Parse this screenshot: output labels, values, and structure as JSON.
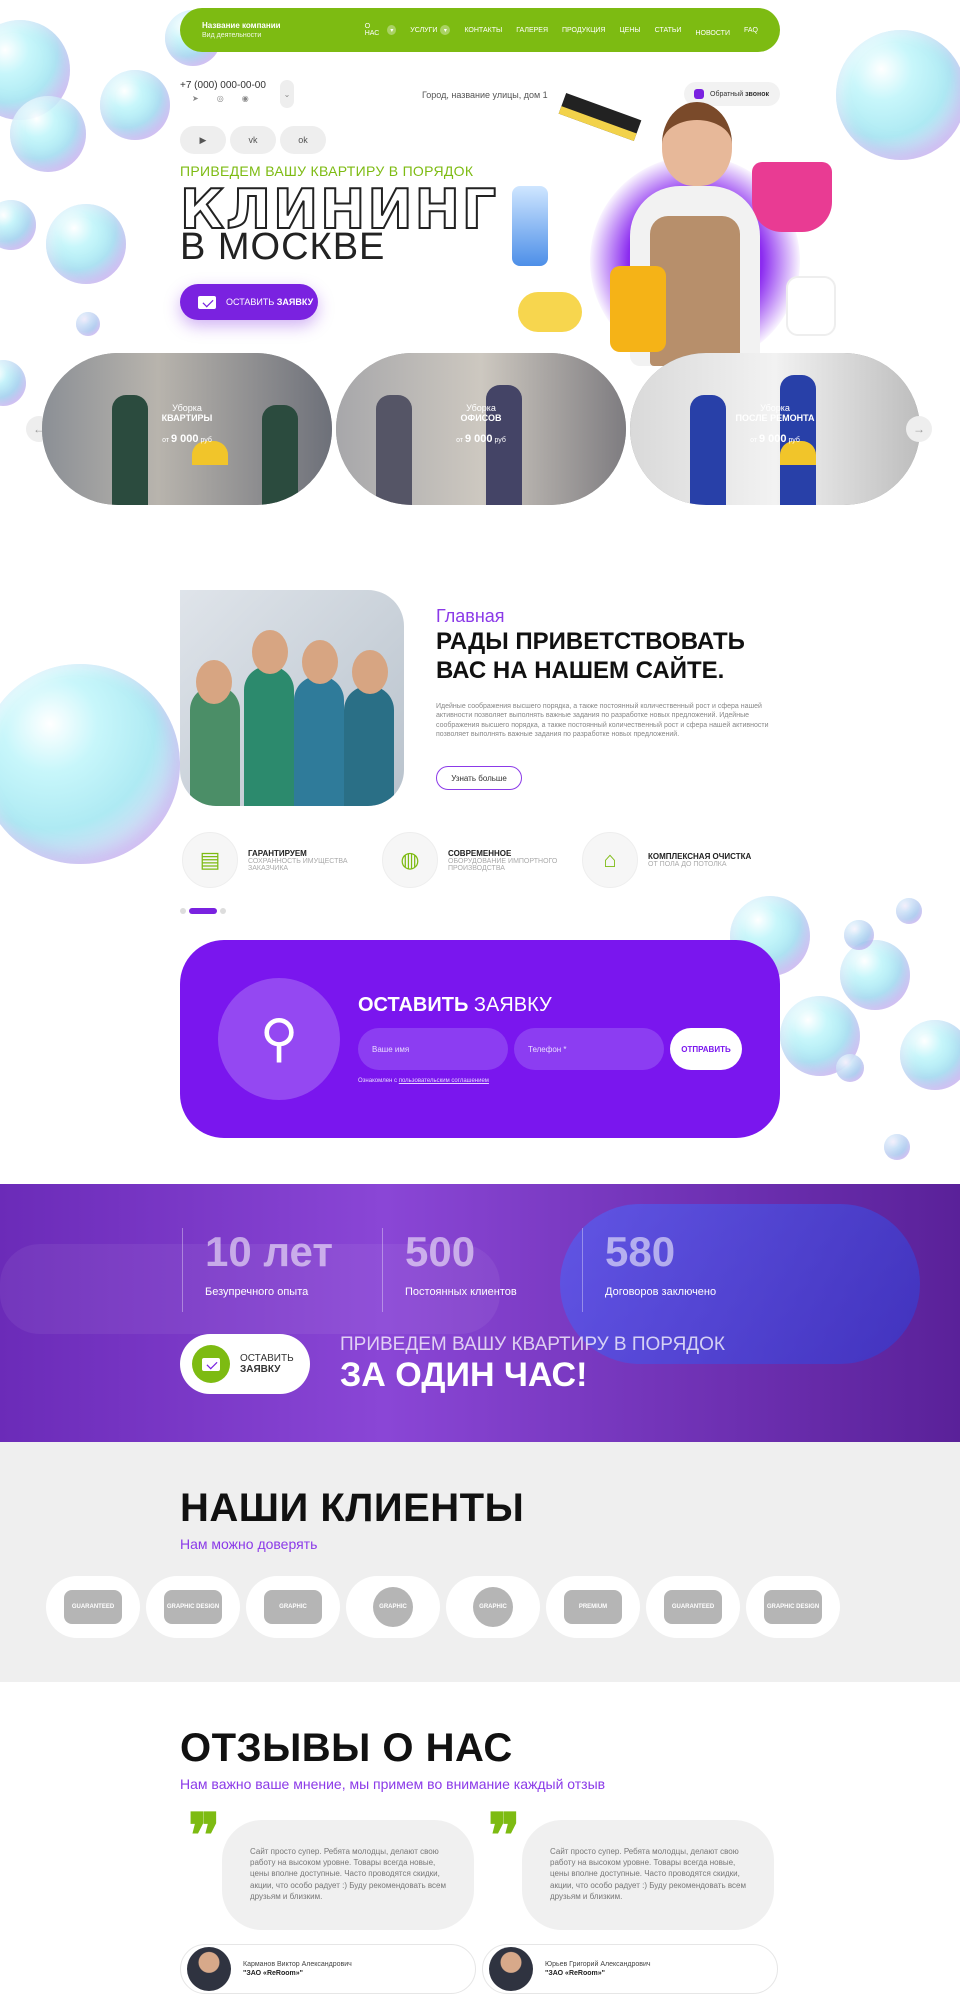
{
  "header": {
    "company_name": "Название компании",
    "company_sub": "Вид деятельности",
    "nav": [
      "О нас",
      "Услуги",
      "Контакты",
      "Галерея",
      "Продукция",
      "Цены",
      "Статьи",
      "Новости",
      "FAQ"
    ]
  },
  "contacts": {
    "phone": "+7 (000) 000-00-00",
    "address": "Город, название улицы, дом 1",
    "callback_prefix": "Обратный",
    "callback_bold": "звонок",
    "socials": [
      "▶",
      "vk",
      "ok"
    ]
  },
  "hero": {
    "subtitle": "Приведем вашу квартиру в порядок",
    "title": "КЛИНИНГ",
    "title2": "В МОСКВЕ",
    "button_prefix": "ОСТАВИТЬ",
    "button_bold": "ЗАЯВКУ"
  },
  "services": [
    {
      "line1": "Уборка",
      "line2": "квартиры",
      "price_prefix": "от",
      "price": "9 000",
      "unit": "руб"
    },
    {
      "line1": "Уборка",
      "line2": "офисов",
      "price_prefix": "от",
      "price": "9 000",
      "unit": "руб"
    },
    {
      "line1": "Уборка",
      "line2": "после ремонта",
      "price_prefix": "от",
      "price": "9 000",
      "unit": "руб"
    }
  ],
  "about": {
    "tag": "Главная",
    "title": "Рады приветствовать вас на нашем сайте.",
    "text": "Идейные соображения высшего порядка, а также постоянный количественный рост и сфера нашей активности позволяет выполнять важные задания по разработке новых предложений. Идейные соображения высшего порядка, а также постоянный количественный рост и сфера нашей активности позволяет выполнять важные задания по разработке новых предложений.",
    "button": "Узнать больше",
    "features": [
      {
        "title": "Гарантируем",
        "text": "сохранность имущества заказчика"
      },
      {
        "title": "Современное",
        "text": "оборудование импортного производства"
      },
      {
        "title": "Комплексная очистка",
        "text": "от пола до потолка"
      }
    ]
  },
  "request": {
    "title_bold": "ОСТАВИТЬ",
    "title_rest": "ЗАЯВКУ",
    "name_placeholder": "Ваше имя",
    "phone_placeholder": "Телефон *",
    "send": "ОТПРАВИТЬ",
    "note_prefix": "Ознакомлен с",
    "note_link": "пользовательским соглашением"
  },
  "stats": [
    {
      "value": "10 лет",
      "label": "Безупречного опыта"
    },
    {
      "value": "500",
      "label": "Постоянных клиентов"
    },
    {
      "value": "580",
      "label": "Договоров заключено"
    }
  ],
  "band": {
    "button_line1": "ОСТАВИТЬ",
    "button_line2": "ЗАЯВКУ",
    "subtitle": "Приведем вашу квартиру в порядок",
    "title": "за один час!"
  },
  "clients": {
    "title": "Наши клиенты",
    "subtitle": "Нам можно доверять",
    "logos": [
      "Guaranteed",
      "Graphic Design",
      "Graphic",
      "Graphic",
      "Graphic",
      "Premium",
      "Guaranteed",
      "Graphic Design"
    ]
  },
  "reviews": {
    "title": "Отзывы о нас",
    "subtitle": "Нам важно ваше мнение, мы примем во внимание каждый отзыв",
    "items": [
      {
        "text": "Сайт просто супер. Ребята молодцы, делают свою работу на высоком уровне. Товары всегда новые, цены вполне доступные. Часто проводятся скидки, акции, что особо радует :) Буду рекомендовать всем друзьям и близким.",
        "name": "Карманов Виктор Александрович",
        "company": "\"ЗАО «ReRoom»\""
      },
      {
        "text": "Сайт просто супер. Ребята молодцы, делают свою работу на высоком уровне. Товары всегда новые, цены вполне доступные. Часто проводятся скидки, акции, что особо радует :) Буду рекомендовать всем друзьям и близким.",
        "name": "Юрьев Григорий Александрович",
        "company": "\"ЗАО «ReRoom»\""
      }
    ]
  },
  "colors": {
    "accent_green": "#7dbb12",
    "accent_purple": "#7a22e0"
  }
}
